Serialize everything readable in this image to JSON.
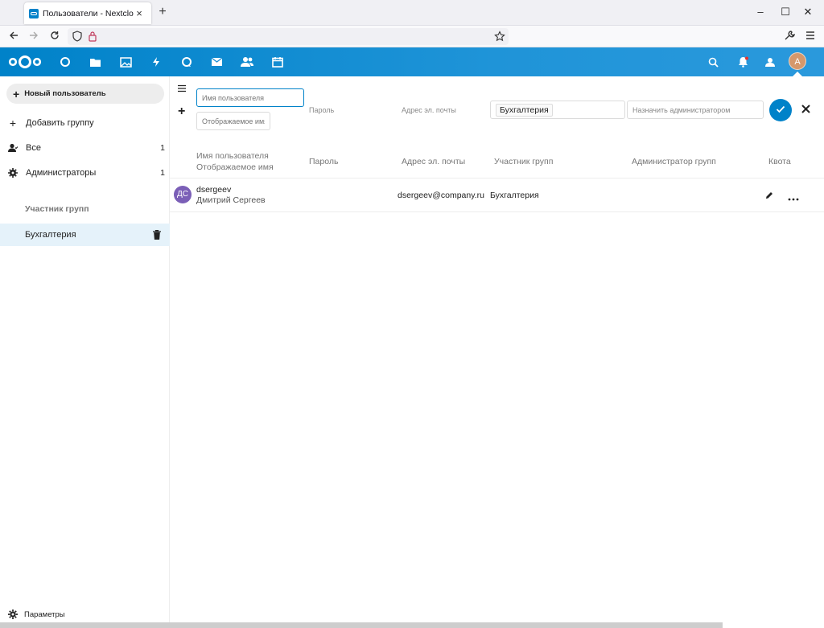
{
  "browser": {
    "tab_title": "Пользователи - Nextcloud",
    "tab_close": "×",
    "new_tab": "+",
    "controls": {
      "minimize": "–",
      "maximize": "☐",
      "close": "✕"
    }
  },
  "header": {
    "avatar_letter": "A",
    "apps": [
      "dashboard-icon",
      "files-icon",
      "photos-icon",
      "activity-icon",
      "talk-icon",
      "mail-icon",
      "contacts-icon",
      "calendar-icon"
    ],
    "right_icons": [
      "search-icon",
      "notifications-icon",
      "contacts-menu-icon"
    ]
  },
  "sidebar": {
    "new_user_label": "Новый пользователь",
    "add_group_label": "Добавить группу",
    "items": [
      {
        "label": "Все",
        "count": "1",
        "icon": "user-icon"
      },
      {
        "label": "Администраторы",
        "count": "1",
        "icon": "admin-gear-icon"
      }
    ],
    "caption": "Участник групп",
    "groups": [
      {
        "label": "Бухгалтерия"
      }
    ],
    "settings_label": "Параметры"
  },
  "new_user_form": {
    "username_placeholder": "Имя пользователя",
    "display_name_placeholder": "Отображаемое имя",
    "password_label": "Пароль",
    "email_label": "Адрес эл. почты",
    "selected_group": "Бухгалтерия",
    "admin_placeholder": "Назначить администратором"
  },
  "table": {
    "headers": {
      "username": "Имя пользователя",
      "display_name": "Отображаемое имя",
      "password": "Пароль",
      "email": "Адрес эл. почты",
      "groups": "Участник групп",
      "admin_groups": "Администратор групп",
      "quota": "Квота"
    },
    "rows": [
      {
        "avatar": "ДС",
        "username": "dsergeev",
        "display_name": "Дмитрий Сергеев",
        "email": "dsergeev@company.ru",
        "groups": "Бухгалтерия"
      }
    ]
  },
  "colors": {
    "accent": "#0082c9",
    "row_avatar": "#7b5fb7",
    "header_avatar": "#d5986c",
    "active_item": "#e5f2fa"
  }
}
